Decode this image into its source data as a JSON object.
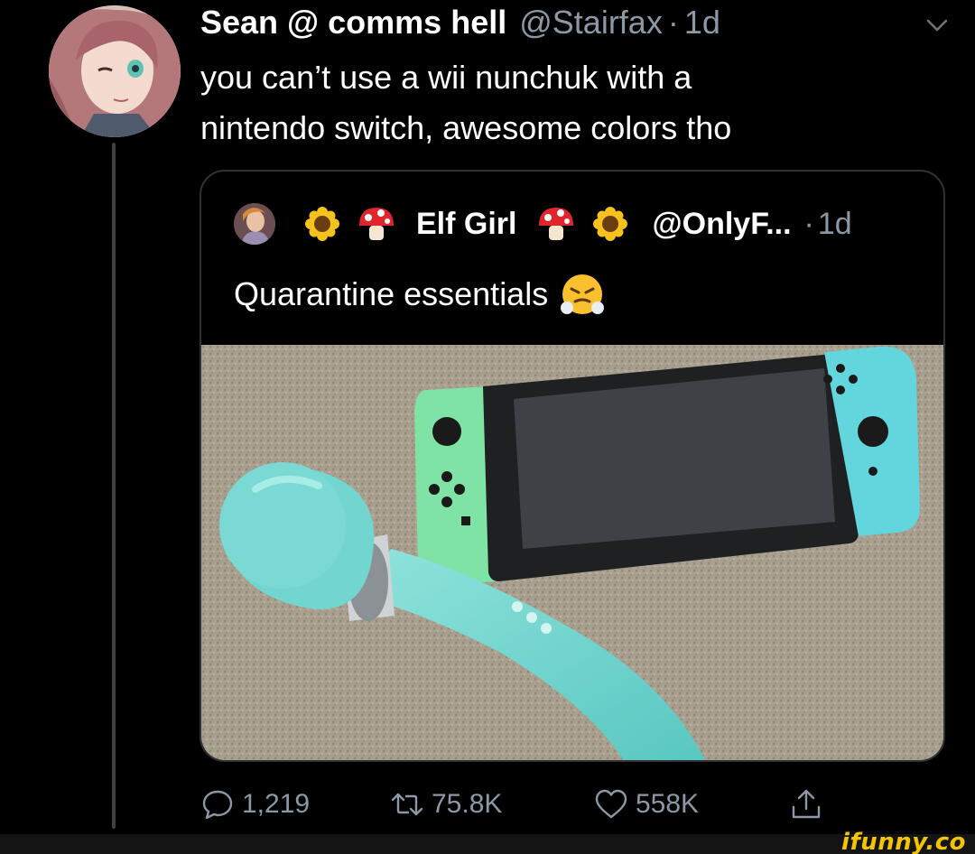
{
  "tweet": {
    "author_name": "Sean @ comms hell",
    "handle": "@Stairfax",
    "separator": "·",
    "time": "1d",
    "lines": [
      "you can’t use a wii nunchuk with a",
      "nintendo switch, awesome colors tho"
    ]
  },
  "quote": {
    "emoji_left": [
      "sunflower",
      "mushroom"
    ],
    "name": "Elf Girl",
    "emoji_right": [
      "mushroom",
      "sunflower"
    ],
    "handle": "@OnlyF...",
    "separator": "·",
    "time": "1d",
    "text": "Quarantine essentials",
    "text_emoji": "face-with-steam-from-nose"
  },
  "actions": {
    "replies": "1,219",
    "retweets": "75.8K",
    "likes": "558K"
  },
  "icons": {
    "reply": "reply-icon",
    "retweet": "retweet-icon",
    "like": "heart-icon",
    "share": "share-icon",
    "menu": "chevron-down-icon"
  },
  "colors": {
    "background": "#000000",
    "secondary_text": "#8b98a5",
    "card_border": "#2f3336",
    "watermark": "#f5c400"
  },
  "watermark": "ifunny.co"
}
